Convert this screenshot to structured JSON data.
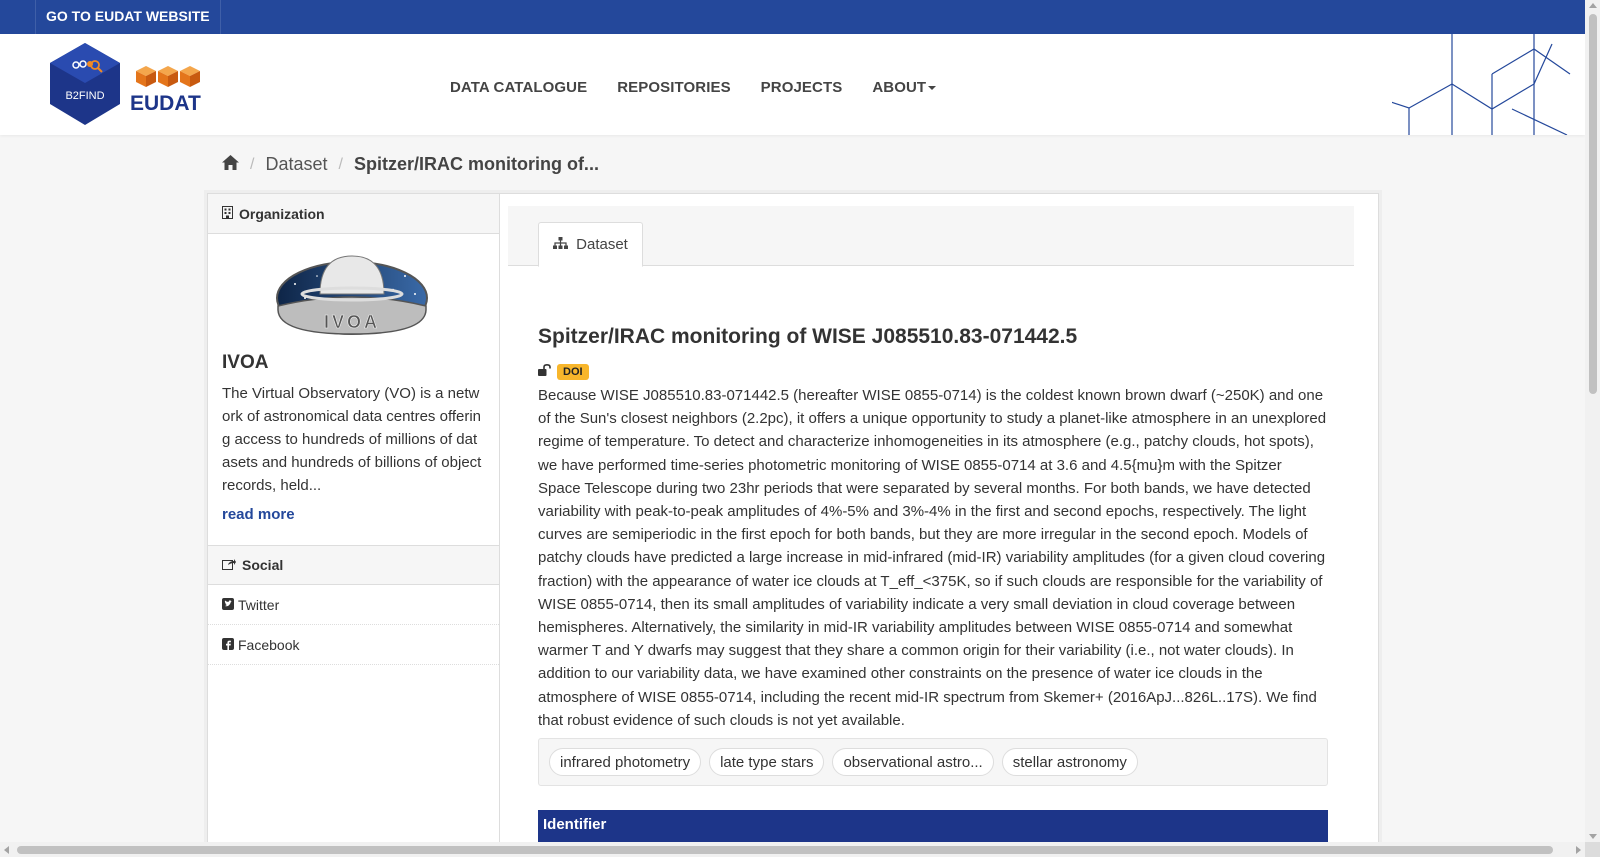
{
  "topbar": {
    "eudat_link": "GO TO EUDAT WEBSITE"
  },
  "logo": {
    "b2find_text": "B2FIND",
    "eudat_text": "EUDAT"
  },
  "nav": [
    {
      "label": "DATA CATALOGUE"
    },
    {
      "label": "REPOSITORIES"
    },
    {
      "label": "PROJECTS"
    },
    {
      "label": "ABOUT"
    }
  ],
  "breadcrumb": {
    "home_icon": "home-icon",
    "dataset": "Dataset",
    "current": "Spitzer/IRAC monitoring of..."
  },
  "sidebar": {
    "org_heading": "Organization",
    "org_logo_text": "IVOA",
    "org_name": "IVOA",
    "org_description": "The Virtual Observatory (VO) is a network of astronomical data centres offering access to hundreds of millions of datasets and hundreds of billions of object records, held...",
    "read_more": "read more",
    "social_heading": "Social",
    "social_items": [
      {
        "icon": "twitter-icon",
        "label": "Twitter"
      },
      {
        "icon": "facebook-icon",
        "label": "Facebook"
      }
    ]
  },
  "main": {
    "tab_label": "Dataset",
    "title": "Spitzer/IRAC monitoring of WISE J085510.83-071442.5",
    "badge_doi": "DOI",
    "abstract": "Because WISE J085510.83-071442.5 (hereafter WISE 0855-0714) is the coldest known brown dwarf (~250K) and one of the Sun's closest neighbors (2.2pc), it offers a unique opportunity to study a planet-like atmosphere in an unexplored regime of temperature. To detect and characterize inhomogeneities in its atmosphere (e.g., patchy clouds, hot spots), we have performed time-series photometric monitoring of WISE 0855-0714 at 3.6 and 4.5{mu}m with the Spitzer Space Telescope during two 23hr periods that were separated by several months. For both bands, we have detected variability with peak-to-peak amplitudes of 4%-5% and 3%-4% in the first and second epochs, respectively. The light curves are semiperiodic in the first epoch for both bands, but they are more irregular in the second epoch. Models of patchy clouds have predicted a large increase in mid-infrared (mid-IR) variability amplitudes (for a given cloud covering fraction) with the appearance of water ice clouds at T_eff_<375K, so if such clouds are responsible for the variability of WISE 0855-0714, then its small amplitudes of variability indicate a very small deviation in cloud coverage between hemispheres. Alternatively, the similarity in mid-IR variability amplitudes between WISE 0855-0714 and somewhat warmer T and Y dwarfs may suggest that they share a common origin for their variability (i.e., not water clouds). In addition to our variability data, we have examined other constraints on the presence of water ice clouds in the atmosphere of WISE 0855-0714, including the recent mid-IR spectrum from Skemer+ (2016ApJ...826L..17S). We find that robust evidence of such clouds is not yet available.",
    "tags": [
      "infrared photometry",
      "late type stars",
      "observational astro...",
      "stellar astronomy"
    ],
    "identifier_heading": "Identifier"
  },
  "colors": {
    "brand_blue": "#24489b",
    "identifier_blue": "#1d3589",
    "doi_badge": "#f8b62b",
    "eudat_orange": "#f08a24"
  }
}
